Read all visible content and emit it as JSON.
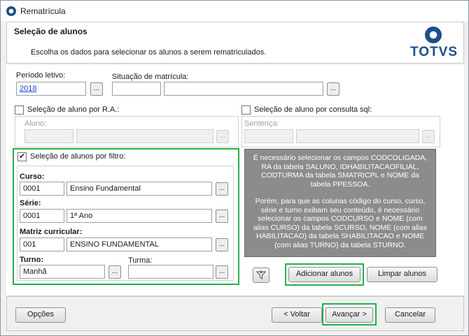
{
  "window": {
    "title": "Rematrícula"
  },
  "header": {
    "title": "Seleção de alunos",
    "description": "Escolha os dados para selecionar os alunos a serem rematriculados.",
    "logo_text": "TOTVS"
  },
  "periodo": {
    "label": "Período letivo:",
    "value": "2018"
  },
  "situacao": {
    "label": "Situação de matrícula:",
    "code": "",
    "description": ""
  },
  "ra": {
    "label": "Seleção de aluno por R.A.:",
    "aluno_label": "Aluno:"
  },
  "sql": {
    "label": "Seleção de aluno por consulta sql:",
    "sentenca_label": "Sentença:"
  },
  "filtro": {
    "label": "Seleção de alunos por filtro:",
    "curso": {
      "label": "Curso:",
      "code": "0001",
      "name": "Ensino Fundamental"
    },
    "serie": {
      "label": "Série:",
      "code": "0001",
      "name": "1ª Ano"
    },
    "matriz": {
      "label": "Matriz curricular:",
      "code": "001",
      "name": "ENSINO FUNDAMENTAL"
    },
    "turno": {
      "label": "Turno:",
      "value": "Manhã"
    },
    "turma": {
      "label": "Turma:",
      "value": ""
    }
  },
  "info_text": {
    "p1": "É necessário selecionar os campos CODCOLIGADA, RA da tabela SALUNO, IDHABILITACAOFILIAL, CODTURMA da tabela SMATRICPL e NOME da tabela PPESSOA.",
    "p2": "Porém, para que as colunas código do curso, curso, série e turno exibam seu conteúdo, é necessário selecionar os campos CODCURSO e NOME (com alias CURSO) da tabela SCURSO, NOME (com alias HABILITACAO) da tabela SHABILITACAO e NOME (com alias TURNO) da tabela STURNO."
  },
  "buttons": {
    "ellipsis": "...",
    "adicionar": "Adicionar alunos",
    "limpar": "Limpar alunos",
    "opcoes": "Opções",
    "voltar": "< Voltar",
    "avancar": "Avançar >",
    "cancelar": "Cancelar"
  },
  "colors": {
    "highlight": "#22b14c",
    "brand": "#1c4e8c",
    "link": "#1a3fd6"
  }
}
